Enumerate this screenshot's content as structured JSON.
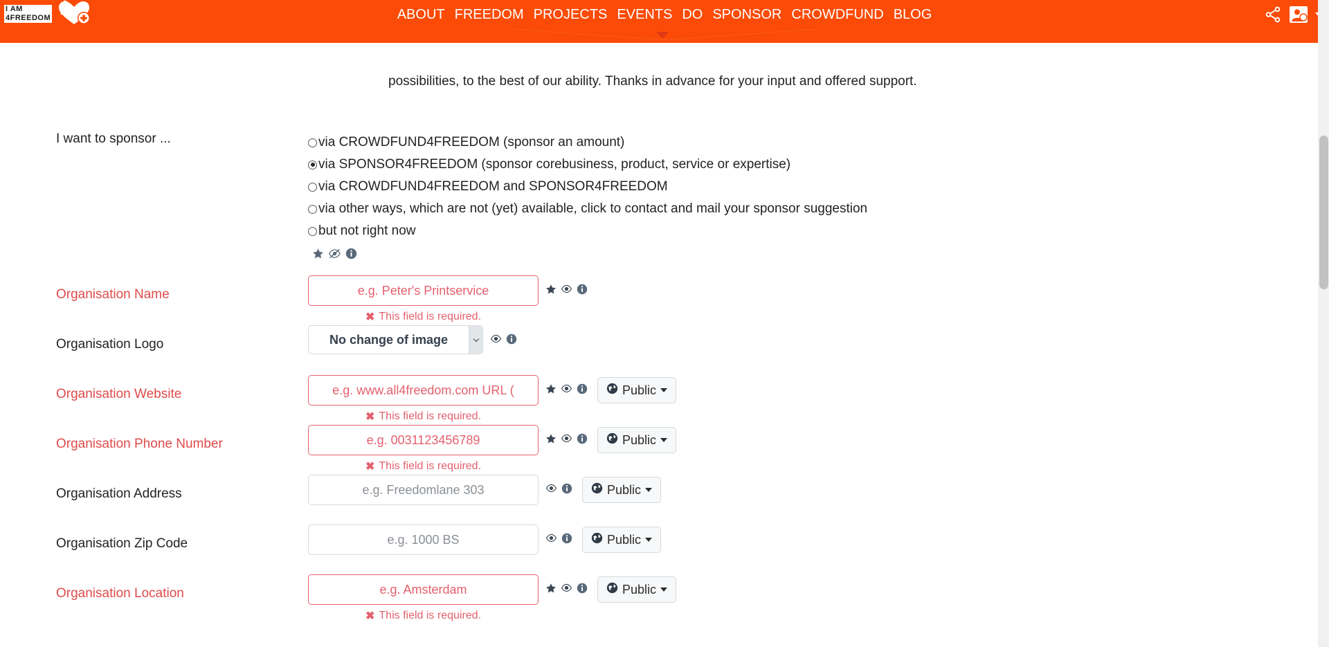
{
  "header": {
    "logo_line1": "I AM",
    "logo_line2": "4FREEDOM",
    "nav": [
      {
        "label": "ABOUT"
      },
      {
        "label": "FREEDOM"
      },
      {
        "label": "PROJECTS"
      },
      {
        "label": "EVENTS"
      },
      {
        "label": "DO"
      },
      {
        "label": "SPONSOR"
      },
      {
        "label": "CROWDFUND"
      },
      {
        "label": "BLOG"
      }
    ],
    "brand_color": "#fb4b06",
    "caret_color": "#e03a14"
  },
  "intro": {
    "text": "possibilities, to the best of our ability. Thanks in advance for your input and offered support."
  },
  "sponsor_group": {
    "label": "I want to sponsor ...",
    "options": [
      {
        "label": "via CROWDFUND4FREEDOM (sponsor an amount)",
        "checked": false
      },
      {
        "label": "via SPONSOR4FREEDOM (sponsor corebusiness, product, service or expertise)",
        "checked": true
      },
      {
        "label": "via CROWDFUND4FREEDOM and SPONSOR4FREEDOM",
        "checked": false
      },
      {
        "label": "via other ways, which are not (yet) available, click to contact and mail your sponsor suggestion",
        "checked": false
      },
      {
        "label": "but not right now",
        "checked": false
      }
    ],
    "icons": [
      "star-icon",
      "eye-slash-icon",
      "info-icon"
    ]
  },
  "error_text": "This field is required.",
  "error_mark": "✖",
  "fields": [
    {
      "label": "Organisation Name",
      "required": true,
      "type": "text",
      "placeholder": "e.g. Peter's Printservice",
      "icons": [
        "star-icon",
        "eye-icon",
        "info-icon"
      ],
      "privacy": null,
      "error": true
    },
    {
      "label": "Organisation Logo",
      "required": false,
      "type": "select",
      "value": "No change of image",
      "icons": [
        "eye-icon",
        "info-icon"
      ],
      "privacy": null,
      "error": false
    },
    {
      "label": "Organisation Website",
      "required": true,
      "type": "text",
      "placeholder": "e.g. www.all4freedom.com URL (",
      "icons": [
        "star-icon",
        "eye-icon",
        "info-icon"
      ],
      "privacy": "Public",
      "error": true
    },
    {
      "label": "Organisation Phone Number",
      "required": true,
      "type": "text",
      "placeholder": "e.g. 0031123456789",
      "icons": [
        "star-icon",
        "eye-icon",
        "info-icon"
      ],
      "privacy": "Public",
      "error": true
    },
    {
      "label": "Organisation Address",
      "required": false,
      "type": "text",
      "placeholder": "e.g. Freedomlane 303",
      "icons": [
        "eye-icon",
        "info-icon"
      ],
      "privacy": "Public",
      "error": false
    },
    {
      "label": "Organisation Zip Code",
      "required": false,
      "type": "text",
      "placeholder": "e.g. 1000 BS",
      "icons": [
        "eye-icon",
        "info-icon"
      ],
      "privacy": "Public",
      "error": false
    },
    {
      "label": "Organisation Location",
      "required": true,
      "type": "text",
      "placeholder": "e.g. Amsterdam",
      "icons": [
        "star-icon",
        "eye-icon",
        "info-icon"
      ],
      "privacy": "Public",
      "error": true
    }
  ]
}
